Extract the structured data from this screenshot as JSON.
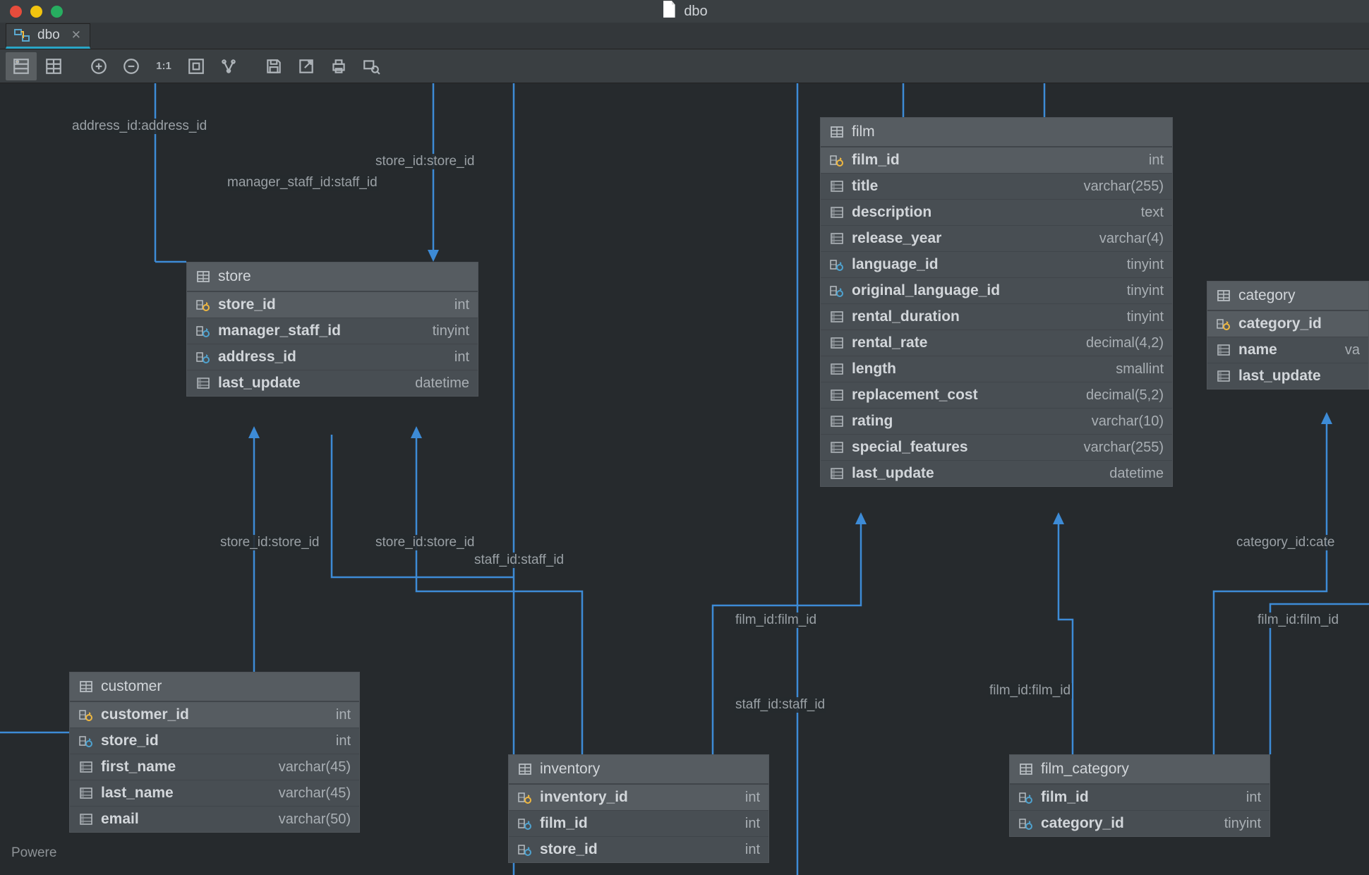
{
  "window": {
    "title": "dbo"
  },
  "tab": {
    "label": "dbo"
  },
  "toolbar": {
    "view_columns": "columns",
    "view_table": "table",
    "zoom_in": "+",
    "zoom_out": "-",
    "zoom_11": "1:1",
    "fit": "fit",
    "layout": "layout",
    "save": "save",
    "export": "export",
    "print": "print",
    "find": "find"
  },
  "footer": "Powere",
  "tables": {
    "store": {
      "title": "store",
      "rows": [
        {
          "name": "store_id",
          "type": "int",
          "kind": "pk"
        },
        {
          "name": "manager_staff_id",
          "type": "tinyint",
          "kind": "fk"
        },
        {
          "name": "address_id",
          "type": "int",
          "kind": "fk"
        },
        {
          "name": "last_update",
          "type": "datetime",
          "kind": "col"
        }
      ]
    },
    "film": {
      "title": "film",
      "rows": [
        {
          "name": "film_id",
          "type": "int",
          "kind": "pk"
        },
        {
          "name": "title",
          "type": "varchar(255)",
          "kind": "col"
        },
        {
          "name": "description",
          "type": "text",
          "kind": "col"
        },
        {
          "name": "release_year",
          "type": "varchar(4)",
          "kind": "col"
        },
        {
          "name": "language_id",
          "type": "tinyint",
          "kind": "fk"
        },
        {
          "name": "original_language_id",
          "type": "tinyint",
          "kind": "fk"
        },
        {
          "name": "rental_duration",
          "type": "tinyint",
          "kind": "col"
        },
        {
          "name": "rental_rate",
          "type": "decimal(4,2)",
          "kind": "col"
        },
        {
          "name": "length",
          "type": "smallint",
          "kind": "col"
        },
        {
          "name": "replacement_cost",
          "type": "decimal(5,2)",
          "kind": "col"
        },
        {
          "name": "rating",
          "type": "varchar(10)",
          "kind": "col"
        },
        {
          "name": "special_features",
          "type": "varchar(255)",
          "kind": "col"
        },
        {
          "name": "last_update",
          "type": "datetime",
          "kind": "col"
        }
      ]
    },
    "category": {
      "title": "category",
      "rows": [
        {
          "name": "category_id",
          "type": "",
          "kind": "pk"
        },
        {
          "name": "name",
          "type": "va",
          "kind": "col"
        },
        {
          "name": "last_update",
          "type": "",
          "kind": "col"
        }
      ]
    },
    "customer": {
      "title": "customer",
      "rows": [
        {
          "name": "customer_id",
          "type": "int",
          "kind": "pk"
        },
        {
          "name": "store_id",
          "type": "int",
          "kind": "fk"
        },
        {
          "name": "first_name",
          "type": "varchar(45)",
          "kind": "col"
        },
        {
          "name": "last_name",
          "type": "varchar(45)",
          "kind": "col"
        },
        {
          "name": "email",
          "type": "varchar(50)",
          "kind": "col"
        }
      ]
    },
    "inventory": {
      "title": "inventory",
      "rows": [
        {
          "name": "inventory_id",
          "type": "int",
          "kind": "pk"
        },
        {
          "name": "film_id",
          "type": "int",
          "kind": "fk"
        },
        {
          "name": "store_id",
          "type": "int",
          "kind": "fk"
        }
      ]
    },
    "film_category": {
      "title": "film_category",
      "rows": [
        {
          "name": "film_id",
          "type": "int",
          "kind": "fk"
        },
        {
          "name": "category_id",
          "type": "tinyint",
          "kind": "fk"
        }
      ]
    }
  },
  "relations": [
    {
      "label": "address_id:address_id"
    },
    {
      "label": "store_id:store_id"
    },
    {
      "label": "manager_staff_id:staff_id"
    },
    {
      "label": "store_id:store_id"
    },
    {
      "label": "store_id:store_id"
    },
    {
      "label": "staff_id:staff_id"
    },
    {
      "label": "film_id:film_id"
    },
    {
      "label": "staff_id:staff_id"
    },
    {
      "label": "film_id:film_id"
    },
    {
      "label": "category_id:cate"
    },
    {
      "label": "film_id:film_id"
    }
  ]
}
